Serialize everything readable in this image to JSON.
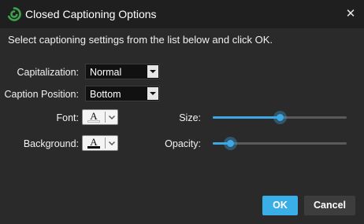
{
  "dialog": {
    "title": "Closed Captioning Options",
    "instruction": "Select captioning settings from the list below and click OK.",
    "icons": {
      "app": "app-logo-icon",
      "close": "close-icon"
    }
  },
  "fields": {
    "capitalization": {
      "label": "Capitalization:",
      "value": "Normal"
    },
    "caption_position": {
      "label": "Caption Position:",
      "value": "Bottom"
    },
    "font": {
      "label": "Font:",
      "glyph": "A",
      "color": "#ffffff"
    },
    "background": {
      "label": "Background:",
      "glyph": "A",
      "color": "#000000"
    },
    "size": {
      "label": "Size:",
      "level_percent": 50
    },
    "opacity": {
      "label": "Opacity:",
      "level_percent": 13
    }
  },
  "buttons": {
    "ok": "OK",
    "cancel": "Cancel"
  },
  "colors": {
    "accent": "#3aaee6",
    "titlebar": "#1f1f1f",
    "background": "#2a2a2a",
    "logo": "#3fa34d"
  }
}
